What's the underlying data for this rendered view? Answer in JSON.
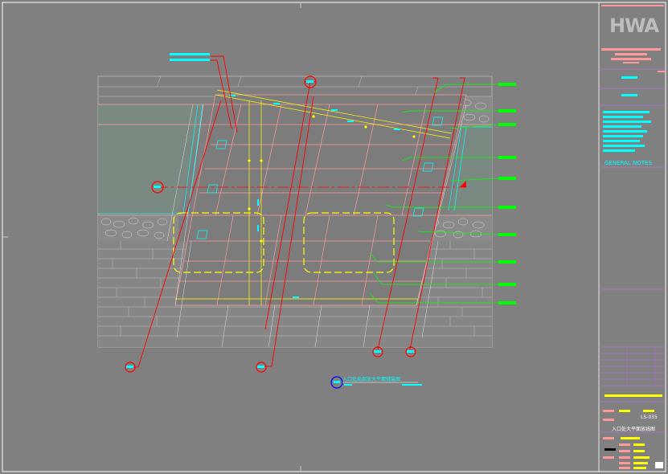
{
  "title_block": {
    "logo_text": "HWA",
    "general_notes_label": "GENERAL NOTES",
    "drawing_no": "LS-035",
    "drawing_title": "入口处大平面放线图"
  },
  "drawing": {
    "caption": "入口处局部放大平面铺装图",
    "section_markers": [
      {
        "id": "A"
      },
      {
        "id": "B"
      },
      {
        "id": "C"
      },
      {
        "id": "D"
      },
      {
        "id": "E"
      },
      {
        "id": "F"
      }
    ]
  },
  "colors": {
    "background": "#808080",
    "frame": "#ffffff",
    "callout_red": "#ff0000",
    "dimension_yellow": "#ffff00",
    "leader_green": "#00ff00",
    "note_cyan": "#00ffff",
    "paving_pink": "#ff9999",
    "tb_pink": "#ff9999",
    "tb_purple": "#cc66ff"
  }
}
